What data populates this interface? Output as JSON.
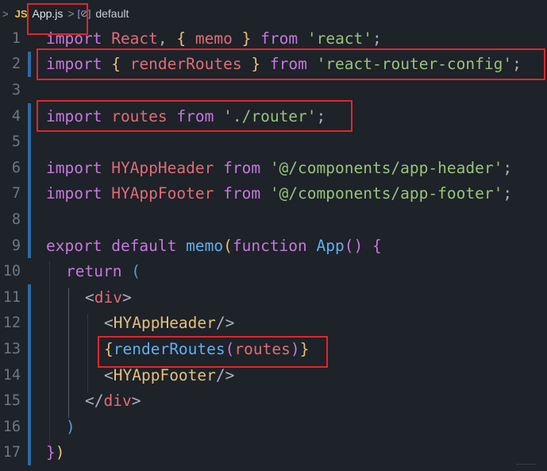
{
  "breadcrumb": {
    "chevron": ">",
    "lang_badge": "JS",
    "file": "App.js",
    "separator": ">",
    "symbol_icon": "[⊘]",
    "symbol": "default"
  },
  "lines": [
    {
      "n": "1"
    },
    {
      "n": "2"
    },
    {
      "n": "3"
    },
    {
      "n": "4"
    },
    {
      "n": "5"
    },
    {
      "n": "6"
    },
    {
      "n": "7"
    },
    {
      "n": "8"
    },
    {
      "n": "9"
    },
    {
      "n": "10"
    },
    {
      "n": "11"
    },
    {
      "n": "12"
    },
    {
      "n": "13"
    },
    {
      "n": "14"
    },
    {
      "n": "15"
    },
    {
      "n": "16"
    },
    {
      "n": "17"
    }
  ],
  "code": {
    "l1": {
      "import": "import",
      "react": "React",
      "comma": ",",
      "lb": "{",
      "memo": "memo",
      "rb": "}",
      "from": "from",
      "src": "'react'",
      "semi": ";"
    },
    "l2": {
      "import": "import",
      "lb": "{",
      "name": "renderRoutes",
      "rb": "}",
      "from": "from",
      "src": "'react-router-config'",
      "semi": ";"
    },
    "l4": {
      "import": "import",
      "name": "routes",
      "from": "from",
      "src": "'./router'",
      "semi": ";"
    },
    "l6": {
      "import": "import",
      "name": "HYAppHeader",
      "from": "from",
      "src": "'@/components/app-header'",
      "semi": ";"
    },
    "l7": {
      "import": "import",
      "name": "HYAppFooter",
      "from": "from",
      "src": "'@/components/app-footer'",
      "semi": ";"
    },
    "l9": {
      "export": "export",
      "default": "default",
      "memo": "memo",
      "lp": "(",
      "function": "function",
      "app": "App",
      "parens": "()",
      "lb": "{"
    },
    "l10": {
      "return": "return",
      "lp": "("
    },
    "l11": {
      "open": "<",
      "tag": "div",
      "close": ">"
    },
    "l12": {
      "open": "<",
      "tag": "HYAppHeader",
      "close": "/>"
    },
    "l13": {
      "lb": "{",
      "fn": "renderRoutes",
      "lp": "(",
      "arg": "routes",
      "rp": ")",
      "rb": "}"
    },
    "l14": {
      "open": "<",
      "tag": "HYAppFooter",
      "close": "/>"
    },
    "l15": {
      "open": "</",
      "tag": "div",
      "close": ">"
    },
    "l16": {
      "rp": ")"
    },
    "l17": {
      "rb": "}",
      "rp": ")"
    }
  },
  "colors": {
    "background": "#1e2229",
    "keyword": "#c678dd",
    "identifier": "#e06c75",
    "string": "#98c379",
    "function": "#61afef",
    "bracket": "#e5c07b",
    "highlight_box": "#e0262a",
    "modified_gutter": "#2c6aa5"
  }
}
